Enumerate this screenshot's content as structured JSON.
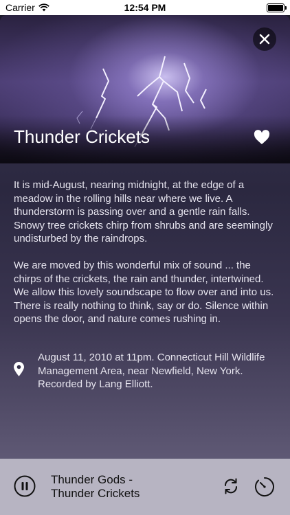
{
  "status_bar": {
    "carrier": "Carrier",
    "time": "12:54 PM"
  },
  "sound": {
    "title": "Thunder Crickets",
    "description": [
      "It is mid-August, nearing midnight, at the edge of a meadow in the rolling hills near where we live. A thunderstorm is passing over and a gentle rain falls. Snowy tree crickets chirp from shrubs and are seemingly undisturbed by the raindrops.",
      "We are moved by this wonderful mix of sound ... the chirps of the crickets, the rain and thunder, intertwined. We allow this lovely soundscape to flow over and into us. There is really nothing to think, say or do. Silence within opens the door, and nature comes rushing in."
    ],
    "location": "August 11, 2010 at 11pm. Connecticut Hill Wildlife Management Area, near Newfield, New York. Recorded by Lang Elliott.",
    "favorite": true
  },
  "player": {
    "line1": "Thunder Gods -",
    "line2": "Thunder Crickets",
    "state": "playing"
  },
  "icons": {
    "close": "close-icon",
    "favorite": "heart-icon",
    "location": "location-pin-icon",
    "pause": "pause-icon",
    "repeat": "repeat-icon",
    "timer": "timer-icon",
    "wifi": "wifi-icon",
    "battery": "battery-icon"
  },
  "colors": {
    "background": "#2b2840",
    "player_bar": "#b7b4c2",
    "text_primary": "#ffffff",
    "text_body": "#e6e4ee"
  }
}
